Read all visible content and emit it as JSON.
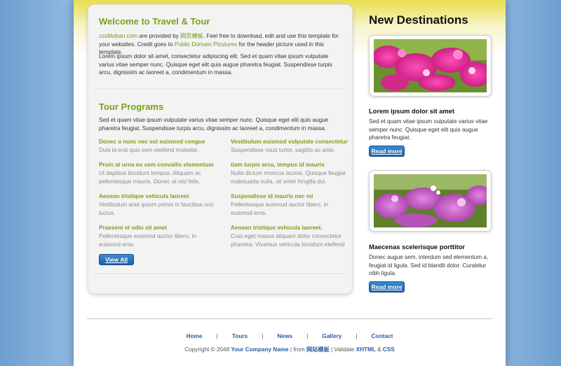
{
  "welcome": {
    "title": "Welcome to Travel & Tour",
    "intro_link1": "cssMoban.com",
    "intro_text1": " are provided by ",
    "intro_link2": "网页模板",
    "intro_text2": ". Feel free to download, edit and use this template for your websites. Credit goes to ",
    "intro_link3": "Public Domain Picutures",
    "intro_text3": " for the header picture used in this template.",
    "lorem": "Lorem ipsum dolor sit amet, consectetur adipiscing elit. Sed et quam vitae ipsum vulputate varius vitae semper nunc. Quisque eget elit quis augue pharetra feugiat. Suspendisse turpis arcu, dignissim ac laoreet a, condimentum in massa."
  },
  "programs": {
    "title": "Tour Programs",
    "text": "Sed et quam vitae ipsum vulputate varius vitae semper nunc. Quisque eget elit quis augue pharetra feugiat. Suspendisse turpis arcu, dignissim ac laoreet a, condimentum in massa.",
    "items": [
      {
        "title": "Donec a nunc nec est euismod congue",
        "desc": "Duis id erat quis sem eleifend molestie."
      },
      {
        "title": "Vestibulum euismod vulputate consectetur",
        "desc": "Suspendisse risus tortor, sagittis ac ante."
      },
      {
        "title": "Proin at urna eu sem convallis elementum",
        "desc": "Ut dapibus tincidunt tempus. Aliquam ac pellentesque mauris. Donec at nisl felis."
      },
      {
        "title": "tiam turpis arcu, tempus id mauris",
        "desc": "Nulla dictum rhoncus lacinia. Quisque feugiat malesuada nulla, sit amet fringilla dui."
      },
      {
        "title": "Aenean tristique vehicula laoreet",
        "desc": "Vestibulum ante ipsum primis in faucibus orci luctus."
      },
      {
        "title": "Suspendisse id mauris nec mi",
        "desc": "Pellentesque euismod auctor libero, in euismod eros."
      },
      {
        "title": "Praesent et odio sit amet",
        "desc": "Pellentesque euismod auctor libero, in euismod eros."
      },
      {
        "title": "Aenean tristique vehicula laoreet.",
        "desc": "Cras eget massa aliquam dolor consectetur pharetra. Vivamus vehicula tincidunt eleifend"
      }
    ],
    "view_all": "View All"
  },
  "sidebar": {
    "title": "New Destinations",
    "destinations": [
      {
        "title": "Lorem ipsum dolor sit amet",
        "text": "Sed et quam vitae ipsum vulputate varius vitae semper nunc. Quisque eget elit quis augue pharetra feugiat.",
        "button": "Read more"
      },
      {
        "title": "Maecenas scelerisque porttitor",
        "text": "Donec augue sem, interdum sed elementum a, feugiat id ligula. Sed id blandit dolor. Curabitur nibh ligula.",
        "button": "Read more"
      }
    ]
  },
  "footer": {
    "nav": [
      "Home",
      "Tours",
      "News",
      "Gallery",
      "Contact"
    ],
    "separator": "|",
    "copyright_prefix": "Copyright © 2048 ",
    "company": "Your Company Name",
    "from_text": " | from ",
    "from_link": "网站模板",
    "validate_text": " | Validate ",
    "xhtml": "XHTML",
    "amp": " & ",
    "css": "CSS"
  },
  "colors": {
    "accent_green": "#7aa21b",
    "link_blue": "#2a5ba6",
    "button_blue": "#1f61a8",
    "header_yellow": "#e9de52"
  }
}
